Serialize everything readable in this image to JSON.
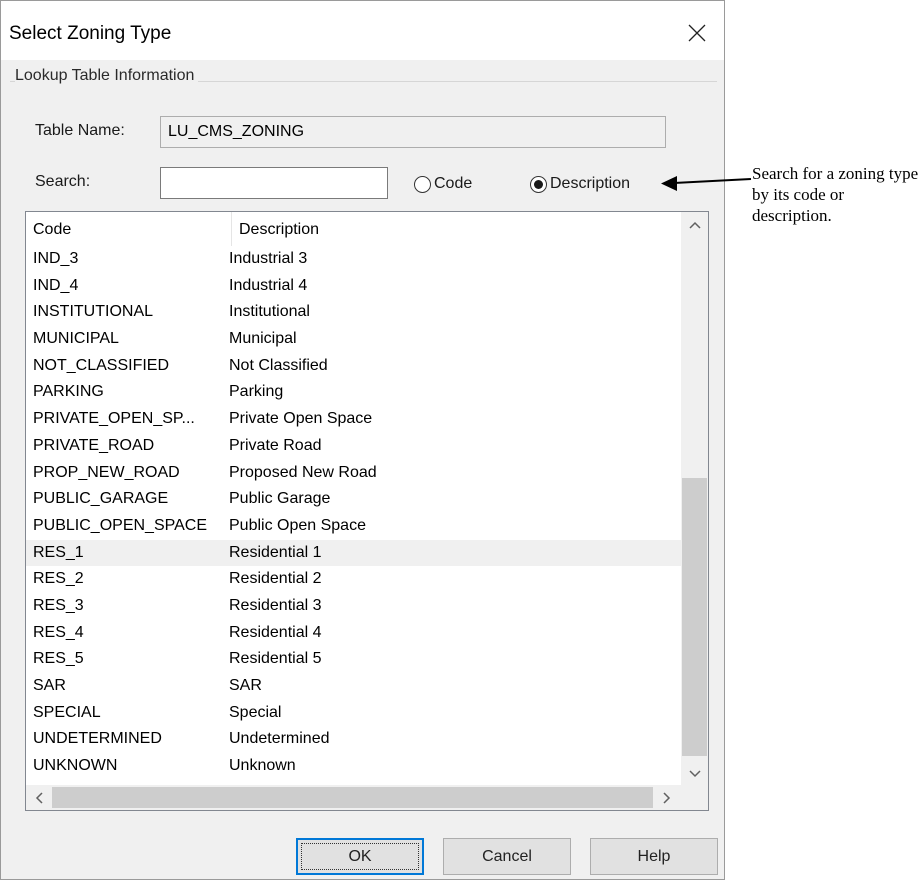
{
  "dialog": {
    "title": "Select Zoning Type",
    "group_label": "Lookup Table Information",
    "table_name_label": "Table Name:",
    "table_name_value": "LU_CMS_ZONING",
    "search_label": "Search:",
    "search_value": "",
    "radio_code_label": "Code",
    "radio_description_label": "Description",
    "selected_search_mode": "Description"
  },
  "table": {
    "columns": [
      "Code",
      "Description"
    ],
    "rows": [
      {
        "code": "IND_3",
        "description": "Industrial 3"
      },
      {
        "code": "IND_4",
        "description": "Industrial 4"
      },
      {
        "code": "INSTITUTIONAL",
        "description": "Institutional"
      },
      {
        "code": "MUNICIPAL",
        "description": "Municipal"
      },
      {
        "code": "NOT_CLASSIFIED",
        "description": "Not Classified"
      },
      {
        "code": "PARKING",
        "description": "Parking"
      },
      {
        "code": "PRIVATE_OPEN_SP...",
        "description": "Private Open Space"
      },
      {
        "code": "PRIVATE_ROAD",
        "description": "Private Road"
      },
      {
        "code": "PROP_NEW_ROAD",
        "description": "Proposed New Road"
      },
      {
        "code": "PUBLIC_GARAGE",
        "description": "Public Garage"
      },
      {
        "code": "PUBLIC_OPEN_SPACE",
        "description": "Public Open Space"
      },
      {
        "code": "RES_1",
        "description": "Residential 1"
      },
      {
        "code": "RES_2",
        "description": "Residential 2"
      },
      {
        "code": "RES_3",
        "description": "Residential 3"
      },
      {
        "code": "RES_4",
        "description": "Residential 4"
      },
      {
        "code": "RES_5",
        "description": "Residential 5"
      },
      {
        "code": "SAR",
        "description": "SAR"
      },
      {
        "code": "SPECIAL",
        "description": "Special"
      },
      {
        "code": "UNDETERMINED",
        "description": "Undetermined"
      },
      {
        "code": "UNKNOWN",
        "description": "Unknown"
      }
    ],
    "selected_code": "RES_1"
  },
  "buttons": {
    "ok": "OK",
    "cancel": "Cancel",
    "help": "Help"
  },
  "annotation": {
    "text": "Search for a zoning type by its code or description."
  },
  "icons": {
    "close": "close-icon",
    "scroll_up": "chevron-up-icon",
    "scroll_down": "chevron-down-icon",
    "scroll_left": "chevron-left-icon",
    "scroll_right": "chevron-right-icon",
    "annotation_arrow": "arrow-left-icon"
  }
}
